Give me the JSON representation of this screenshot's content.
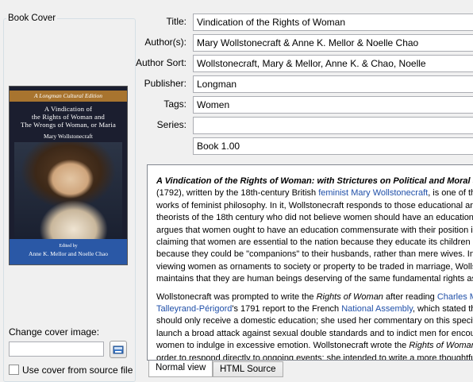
{
  "cover": {
    "group_title": "Book Cover",
    "banner": "A Longman Cultural Edition",
    "title_line1": "A Vindication of",
    "title_line2": "the Rights of Woman and",
    "title_line3": "The Wrongs of Woman, or Maria",
    "author": "Mary Wollstonecraft",
    "edited_by": "Edited by",
    "editors": "Anne K. Mellor and Noelle Chao",
    "change_label": "Change cover image:",
    "path_value": "",
    "use_source_label": "Use cover from source file",
    "use_source_checked": false
  },
  "fields": {
    "title_label": "Title:",
    "title_value": "Vindication of the Rights of Woman",
    "authors_label": "Author(s):",
    "authors_value": "Mary Wollstonecraft & Anne K. Mellor & Noelle Chao",
    "author_sort_label": "Author Sort:",
    "author_sort_value": "Wollstonecraft, Mary & Mellor, Anne K. & Chao, Noelle",
    "publisher_label": "Publisher:",
    "publisher_value": "Longman",
    "tags_label": "Tags:",
    "tags_value": "Women",
    "series_label": "Series:",
    "series_value": "",
    "series_index": "Book 1.00"
  },
  "description": {
    "p1_bold": "A Vindication of the Rights of Woman: with Strictures on Political and Moral Subjects",
    "p1_a": " (1792), written by the 18th-century British ",
    "p1_link1": "feminist",
    "p1_link2": "Mary Wollstonecraft",
    "p1_b": ", is one of the earliest works of feminist philosophy. In it, Wollstonecraft responds to those educational and political theorists of the 18th century who did not believe women should have an education. She argues that women ought to have an education commensurate with their position in society, claiming that women are essential to the nation because they educate its children and because they could be \"companions\" to their husbands, rather than mere wives. Instead of viewing women as ornaments to society or property to be traded in marriage, Wollstonecraft maintains that they are human beings deserving of the same fundamental rights as men.",
    "p2_a": "Wollstonecraft was prompted to write the ",
    "p2_i1": "Rights of Woman",
    "p2_b": " after reading ",
    "p2_link1": "Charles Maurice de Talleyrand-Périgord",
    "p2_c": "'s 1791 report to the French ",
    "p2_link2": "National Assembly",
    "p2_d": ", which stated that women should only receive a domestic education; she used her commentary on this specific event to launch a broad attack against sexual double standards and to indict men for encouraging women to indulge in excessive emotion. Wollstonecraft wrote the ",
    "p2_i2": "Rights of Woman",
    "p2_e": " hurriedly in order to respond directly to ongoing events; she intended to write a more thoughtful second volume but died before completing it."
  },
  "tabs": {
    "normal": "Normal view",
    "html": "HTML Source"
  }
}
